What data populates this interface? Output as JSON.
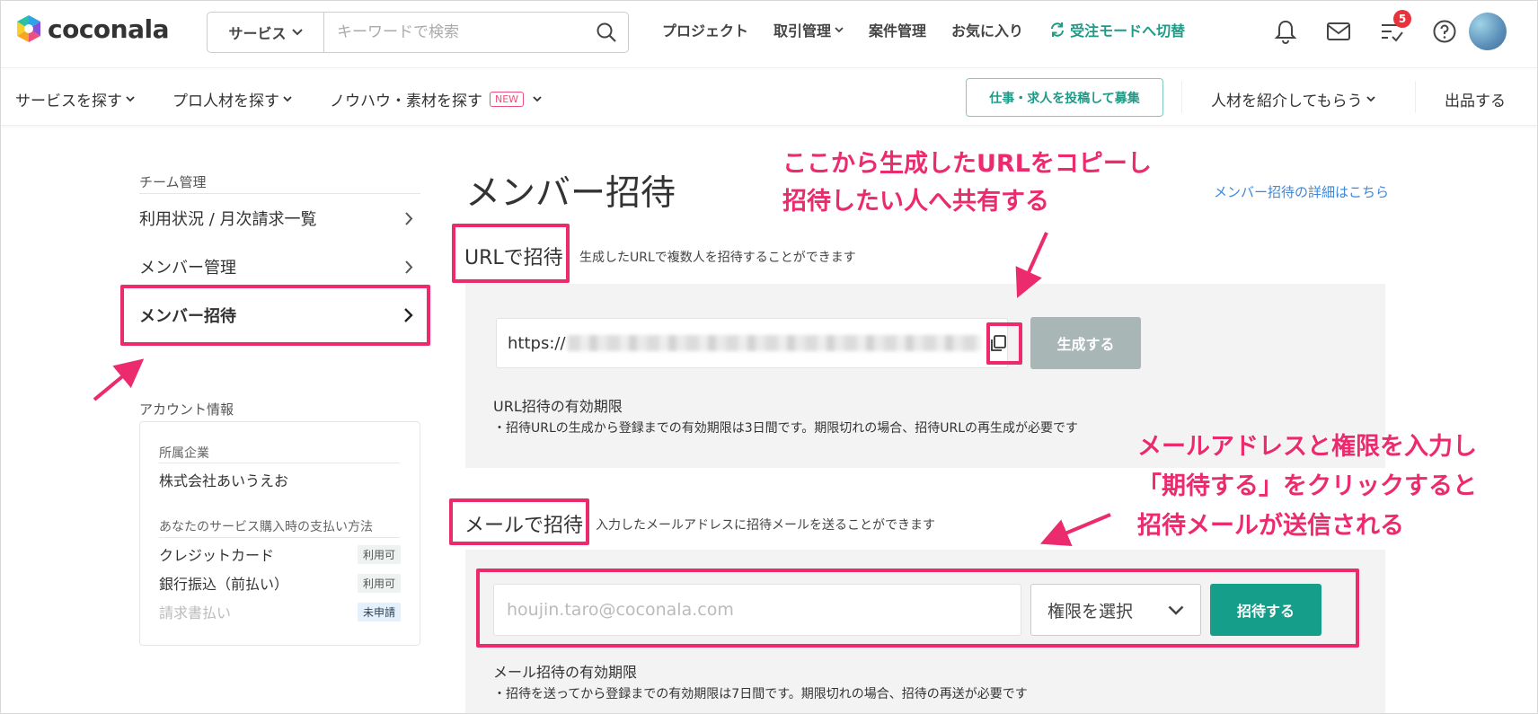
{
  "header": {
    "logo_text": "coconala",
    "search": {
      "category": "サービス",
      "placeholder": "キーワードで検索"
    },
    "nav": [
      {
        "label": "プロジェクト"
      },
      {
        "label": "取引管理"
      },
      {
        "label": "案件管理"
      },
      {
        "label": "お気に入り"
      },
      {
        "label": "受注モードへ切替"
      }
    ],
    "todo_badge": "5"
  },
  "subnav": {
    "items": [
      {
        "label": "サービスを探す"
      },
      {
        "label": "プロ人材を探す"
      },
      {
        "label": "ノウハウ・素材を探す"
      }
    ],
    "new_badge": "NEW",
    "post_job": "仕事・求人を投稿して募集",
    "referral": "人材を紹介してもらう",
    "sell": "出品する"
  },
  "sidebar": {
    "team_title": "チーム管理",
    "items": [
      {
        "label": "利用状況 / 月次請求一覧"
      },
      {
        "label": "メンバー管理"
      },
      {
        "label": "メンバー招待"
      }
    ],
    "account_title": "アカウント情報",
    "company_label": "所属企業",
    "company_value": "株式会社あいうえお",
    "payment_label": "あなたのサービス購入時の支払い方法",
    "payments": [
      {
        "label": "クレジットカード",
        "status": "利用可"
      },
      {
        "label": "銀行振込（前払い）",
        "status": "利用可"
      },
      {
        "label": "請求書払い",
        "status": "未申請"
      }
    ]
  },
  "main": {
    "title": "メンバー招待",
    "detail_link": "メンバー招待の詳細はこちら",
    "url_section": {
      "title": "URLで招待",
      "desc": "生成したURLで複数人を招待することができます",
      "url_prefix": "https://",
      "generate_button": "生成する",
      "expiry_title": "URL招待の有効期限",
      "expiry_text": "・招待URLの生成から登録までの有効期限は3日間です。期限切れの場合、招待URLの再生成が必要です"
    },
    "mail_section": {
      "title": "メールで招待",
      "desc": "入力したメールアドレスに招待メールを送ることができます",
      "email_placeholder": "houjin.taro@coconala.com",
      "role_select": "権限を選択",
      "invite_button": "招待する",
      "expiry_title": "メール招待の有効期限",
      "expiry_text": "・招待を送ってから登録までの有効期限は7日間です。期限切れの場合、招待の再送が必要です"
    }
  },
  "annotations": {
    "url_note_1": "ここから生成したURLをコピーし",
    "url_note_2": "招待したい人へ共有する",
    "mail_note_1": "メールアドレスと権限を入力し",
    "mail_note_2": "「期待する」をクリックすると",
    "mail_note_3": "招待メールが送信される"
  },
  "colors": {
    "accent": "#1f9a87",
    "annotation": "#ec2a6e",
    "link": "#3b87d9"
  }
}
